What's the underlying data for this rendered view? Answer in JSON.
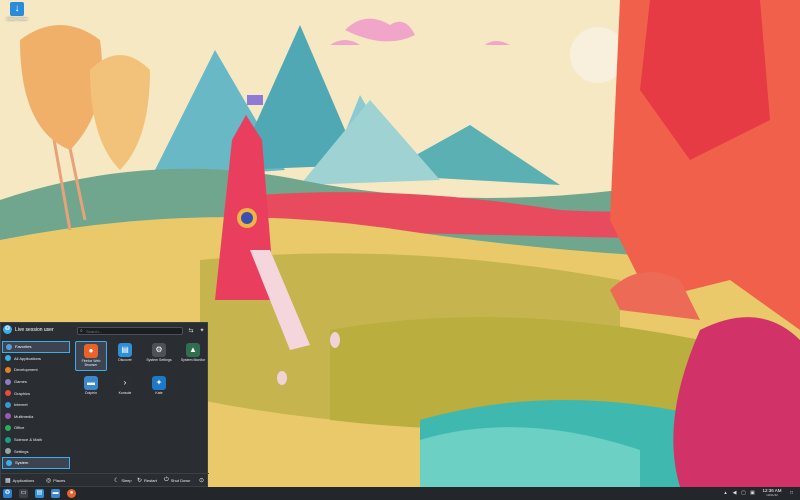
{
  "desktop": {
    "icon_label": "Install Debian"
  },
  "launcher": {
    "user": "Live session user",
    "search_placeholder": "Search...",
    "categories": [
      {
        "label": "Favorites",
        "color": "#5b9bd5"
      },
      {
        "label": "All Applications",
        "color": "#3daee9"
      },
      {
        "label": "Development",
        "color": "#e67e22"
      },
      {
        "label": "Games",
        "color": "#8e7cc3"
      },
      {
        "label": "Graphics",
        "color": "#e74c3c"
      },
      {
        "label": "Internet",
        "color": "#3498db"
      },
      {
        "label": "Multimedia",
        "color": "#9b59b6"
      },
      {
        "label": "Office",
        "color": "#27ae60"
      },
      {
        "label": "Science & Math",
        "color": "#16a085"
      },
      {
        "label": "Settings",
        "color": "#95a5a6"
      },
      {
        "label": "System",
        "color": "#3daee9"
      }
    ],
    "apps": [
      {
        "label": "Firefox Web Browser",
        "color": "#e8632b",
        "glyph": "●"
      },
      {
        "label": "Discover",
        "color": "#2d8fd8",
        "glyph": "▤"
      },
      {
        "label": "System Settings",
        "color": "#4d5258",
        "glyph": "⚙"
      },
      {
        "label": "System Monitor",
        "color": "#2f6f4f",
        "glyph": "▲"
      },
      {
        "label": "Dolphin",
        "color": "#3b88cf",
        "glyph": "▬"
      },
      {
        "label": "Konsole",
        "color": "#2b2f33",
        "glyph": "›"
      },
      {
        "label": "Kate",
        "color": "#1d78c8",
        "glyph": "✦"
      }
    ],
    "footer": {
      "applications": "Applications",
      "places": "Places",
      "sleep": "Sleep",
      "restart": "Restart",
      "shutdown": "Shut Down"
    }
  },
  "taskbar": {
    "time": "12:36 AM",
    "date": "10/21/22"
  }
}
